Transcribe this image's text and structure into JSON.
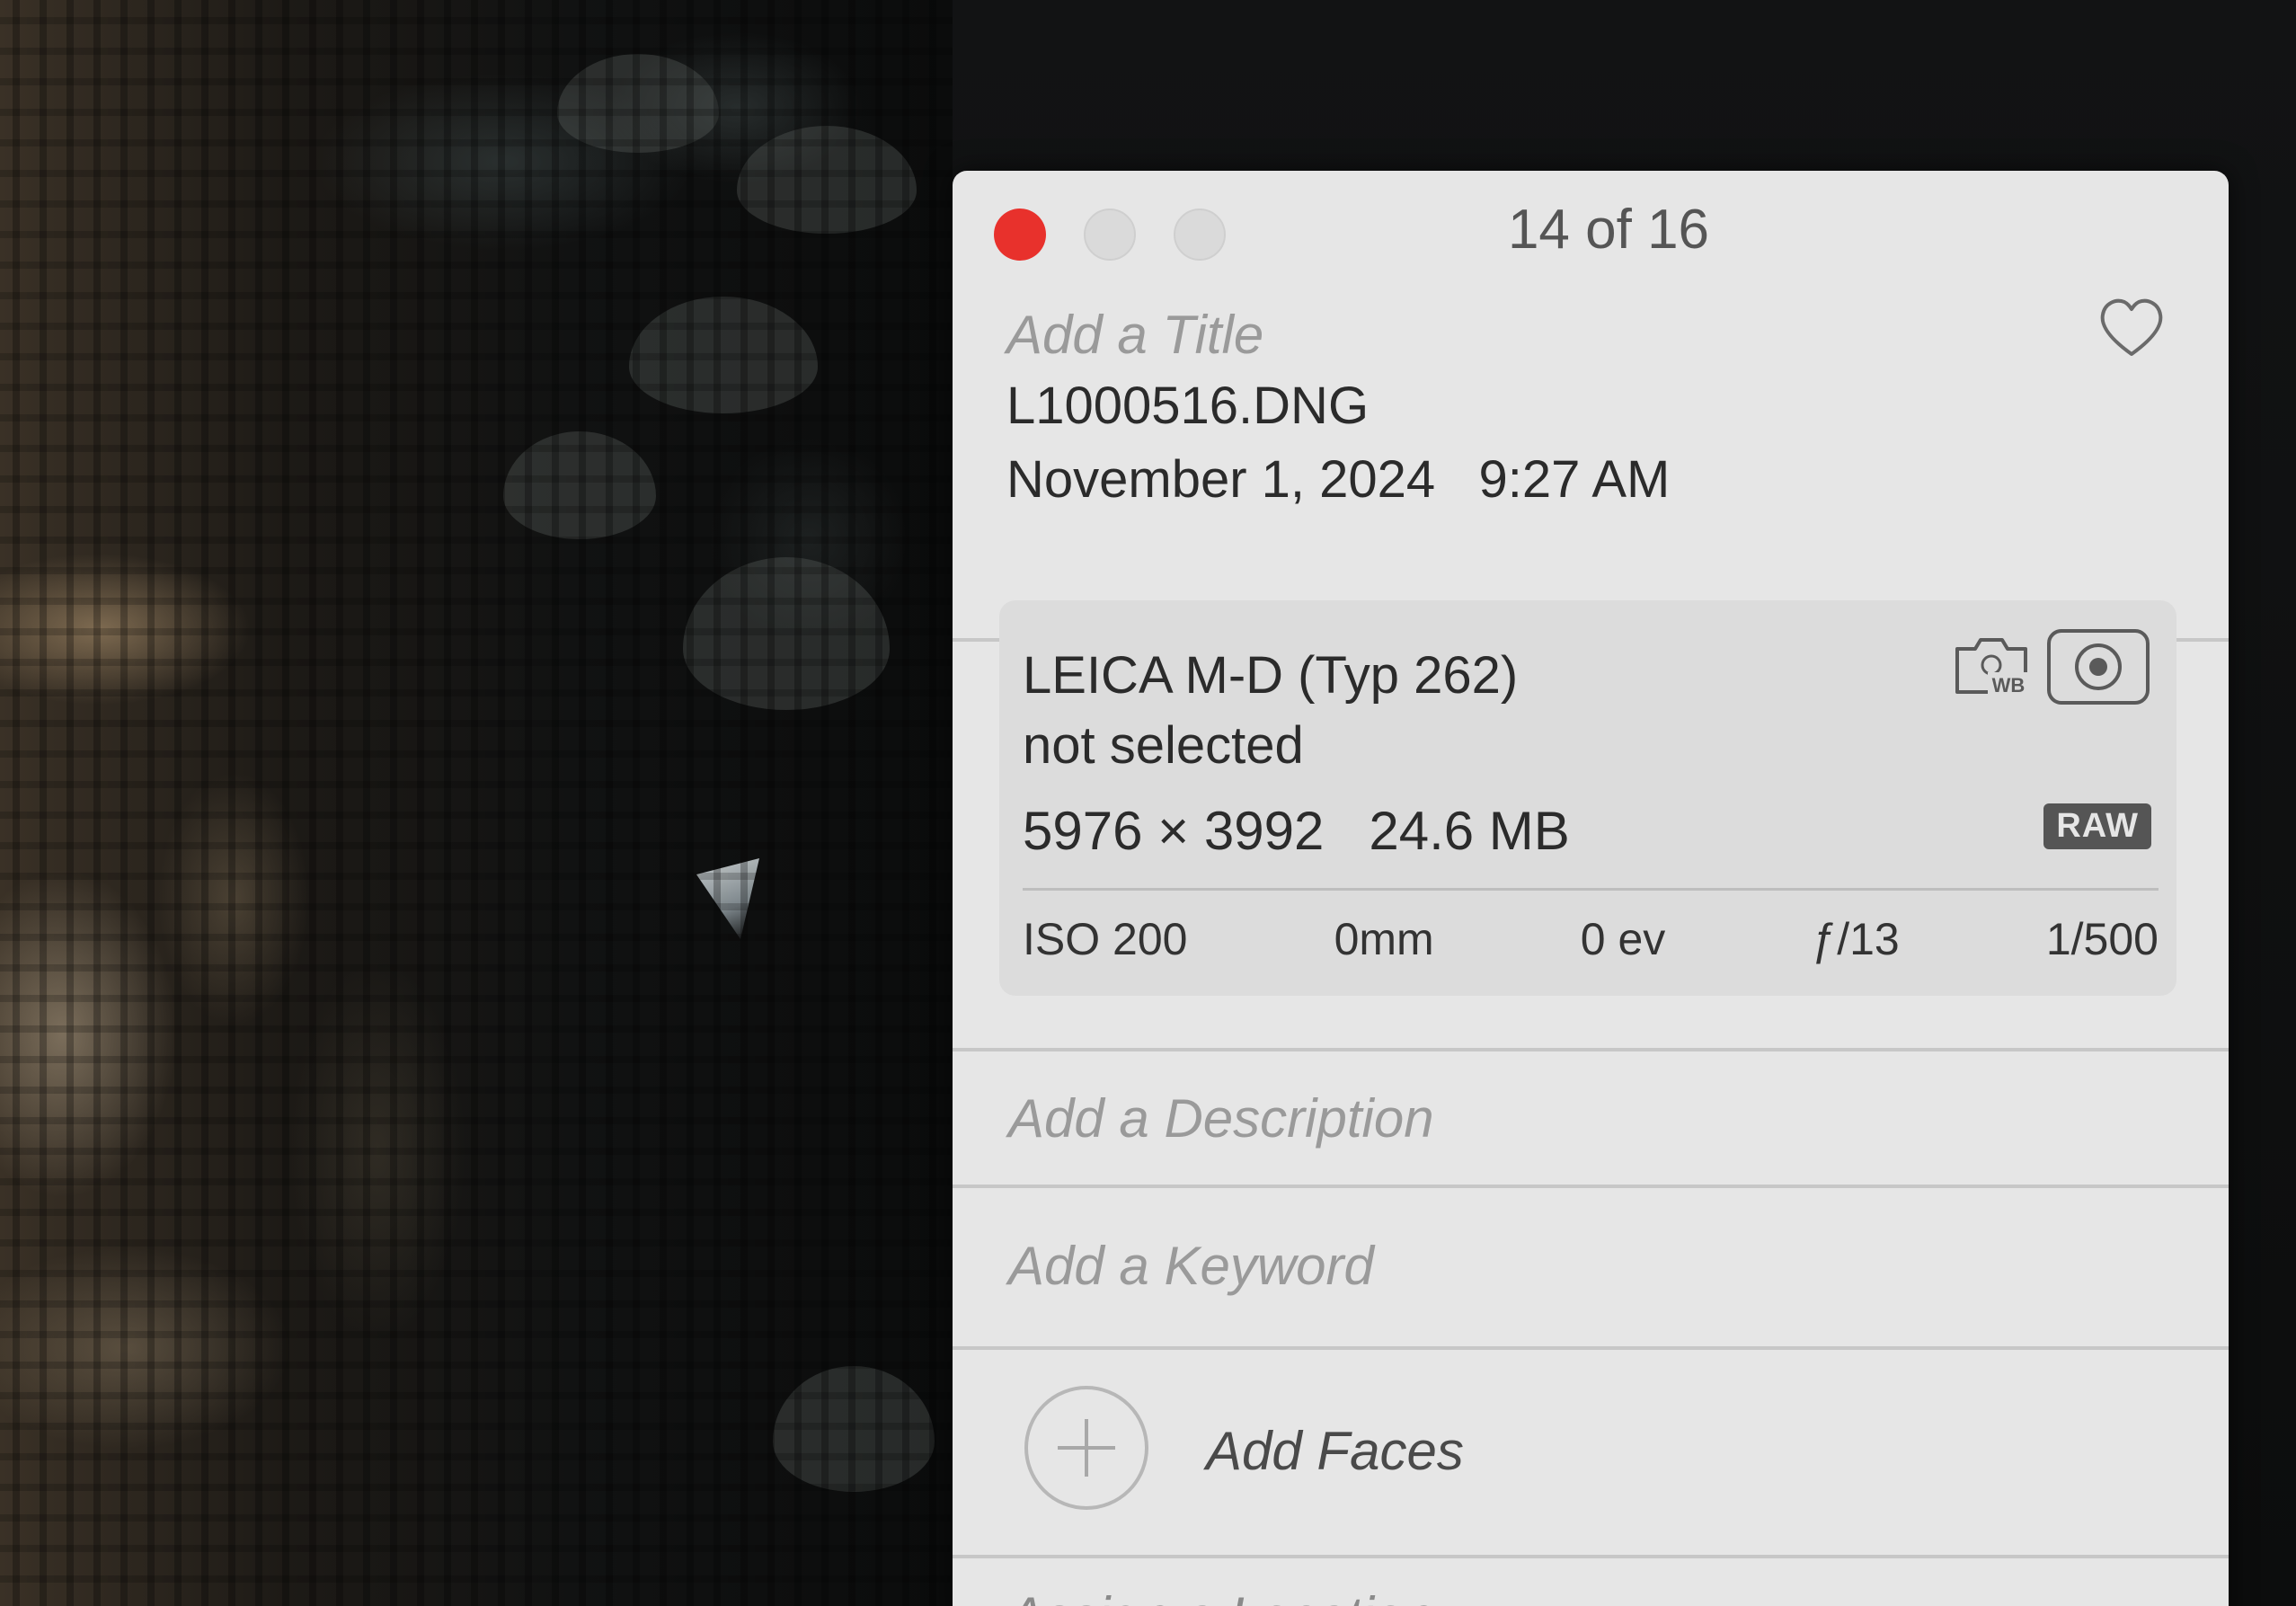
{
  "window": {
    "counter": "14 of 16"
  },
  "info": {
    "title_placeholder": "Add a Title",
    "filename": "L1000516.DNG",
    "date": "November 1, 2024",
    "time": "9:27 AM"
  },
  "camera": {
    "model": "LEICA M-D (Typ 262)",
    "lens": "not selected",
    "dimensions": "5976 × 3992",
    "file_size": "24.6 MB",
    "format_badge": "RAW",
    "exif": {
      "iso": "ISO 200",
      "focal_length": "0mm",
      "exposure_comp": "0 ev",
      "aperture": "ƒ/13",
      "shutter": "1/500"
    }
  },
  "fields": {
    "description_placeholder": "Add a Description",
    "keyword_placeholder": "Add a Keyword",
    "faces_label": "Add Faces",
    "location_placeholder": "Assign a Location"
  },
  "colors": {
    "close_button": "#e8312c",
    "panel_background": "#e6e6e6"
  }
}
